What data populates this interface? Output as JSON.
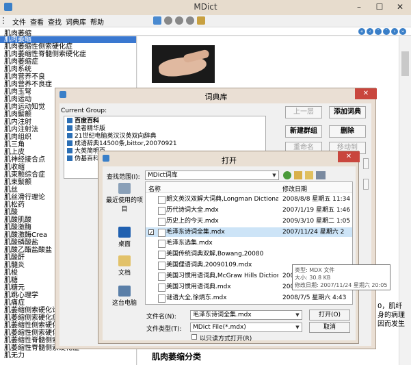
{
  "app_title": "MDict",
  "menu": [
    "文件",
    "查看",
    "查找",
    "词典库",
    "帮助"
  ],
  "search_value": "肌肉萎缩",
  "sidebar_items": [
    "肌肉萎缩",
    "肌肉萎缩性侧索硬化症",
    "肌肉萎缩性脊髓侧索硬化症",
    "肌肉萎缩症",
    "肌肉系统",
    "肌肉营养不良",
    "肌肉营养不良症",
    "肌肉玉弩",
    "肌肉运动",
    "肌肉运动知觉",
    "肌肉鬃颤",
    "肌内注射",
    "肌内注射法",
    "肌肉组织",
    "肌三角",
    "肌上皮",
    "肌神经接合点",
    "肌收缩",
    "肌束颤综合症",
    "肌束鬃颤",
    "肌丝",
    "肌丝滑行理论",
    "肌松药",
    "肌酸",
    "肌酸肌酸",
    "肌酸激酶",
    "肌酸激酶Crea",
    "肌酸磷酸盐",
    "肌酸乙酯盐酸盐",
    "肌酸酐",
    "肌髓炎",
    "肌梭",
    "肌糖",
    "肌糖元",
    "肌跳心理学",
    "肌痛症",
    "肌萎缩侧索硬化诊断标准",
    "肌萎缩侧索硬化症",
    "肌萎缩性侧索硬化",
    "肌萎缩性侧索硬化症",
    "肌萎缩性脊髓侧索硬化病",
    "肌萎缩性脊髓侧索硬化症",
    "肌无力"
  ],
  "content": {
    "right_text_1": "0，肌纤",
    "right_text_2": "身的病理",
    "right_text_3": "因而发生",
    "bottom_title": "肌肉萎缩分类"
  },
  "dict_dialog": {
    "title": "词典库",
    "current_group_label": "Current Group:",
    "groups": [
      "百度百科",
      "读者精华版",
      "21世纪电脑英汉汉英双向辞典",
      "成语辞典14500条,bittor,20070921",
      "大英简明百",
      "伪基百科中"
    ],
    "buttons": {
      "up": "上一层",
      "add_dict": "添加词典",
      "new_group": "新建群组",
      "delete": "删除",
      "rename": "重命名",
      "move_to": "移动到"
    }
  },
  "open_dialog": {
    "title": "打开",
    "lookin_label": "查找范围(I):",
    "lookin_value": "MDict词库",
    "col_name": "名称",
    "col_date": "修改日期",
    "places": [
      "最近使用的项目",
      "桌面",
      "文档",
      "这台电脑"
    ],
    "files": [
      {
        "name": "朗文英汉双解大词典,Longman Dictionary of ...",
        "date": "2008/8/8 星期五 11:34"
      },
      {
        "name": "历代诗词大全.mdx",
        "date": "2007/1/19 星期五 1:46"
      },
      {
        "name": "历史上的今天.mdx",
        "date": "2009/3/10 星期二 1:05"
      },
      {
        "name": "毛泽东诗词全集.mdx",
        "date": "2007/11/24 星期六 2",
        "selected": true
      },
      {
        "name": "毛泽东选集.mdx",
        "date": ""
      },
      {
        "name": "美国传统词典双解,Bowang,20080",
        "date": ""
      },
      {
        "name": "美国俚语词典,20090109.mdx",
        "date": ""
      },
      {
        "name": "美国习惯用语词典,McGraw Hills Dictionary o...",
        "date": "2009/1/28 星期三 4:55"
      },
      {
        "name": "美国习惯用语词典.mdx",
        "date": "2009/1/28 星期三 5:09"
      },
      {
        "name": "谜语大全,徐炳东.mdx",
        "date": "2008/7/5 星期六 4:43"
      }
    ],
    "tooltip": [
      "类型: MDX 文件",
      "大小: 30.8 KB",
      "修改日期: 2007/11/24 星期六 20:05"
    ],
    "filename_label": "文件名(N):",
    "filename_value": "毛泽东诗词全集.mdx",
    "filetype_label": "文件类型(T):",
    "filetype_value": "MDict File(*.mdx)",
    "readonly_label": "以只读方式打开(R)",
    "open_button": "打开(O)",
    "cancel_button": "取消"
  },
  "colors": {
    "accent": "#3a78d0",
    "dialog_frame": "#eadfd4"
  }
}
